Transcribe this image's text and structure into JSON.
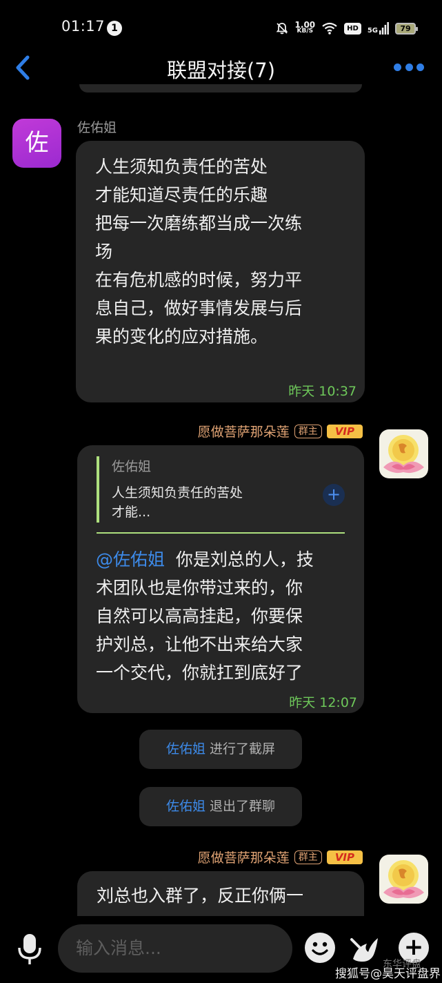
{
  "status_bar": {
    "time": "01:17",
    "notification_count": "1",
    "net_speed_value": "1.00",
    "net_speed_unit": "KB/S",
    "hd": "HD",
    "network": "5G",
    "battery": "79"
  },
  "header": {
    "title": "联盟对接(7)"
  },
  "messages": [
    {
      "sender": "佐佑姐",
      "avatar_char": "佐",
      "text": "人生须知负责任的苦处\n才能知道尽责任的乐趣\n把每一次磨练都当成一次练\n场\n在有危机感的时候，努力平\n息自己，做好事情发展与后\n果的变化的应对措施。",
      "time": "昨天 10:37"
    },
    {
      "sender": "愿做菩萨那朵莲",
      "role_tag": "群主",
      "vip_tag": "VIP",
      "quote_name": "佐佑姐",
      "quote_text": "人生须知负责任的苦处\n才能...",
      "mention": "@佐佑姐",
      "text": "  你是刘总的人，技\n术团队也是你带过来的，你\n自然可以高高挂起，你要保\n护刘总，让他不出来给大家\n一个交代，你就扛到底好了",
      "time": "昨天 12:07"
    },
    {
      "sender": "愿做菩萨那朵莲",
      "role_tag": "群主",
      "vip_tag": "VIP",
      "text": "刘总也入群了，反正你俩一"
    }
  ],
  "system_notices": [
    {
      "who": "佐佑姐",
      "action": " 进行了截屏"
    },
    {
      "who": "佐佑姐",
      "action": " 退出了群聊"
    }
  ],
  "input": {
    "placeholder": "输入消息..."
  },
  "watermark": {
    "top_text": "东华评盘",
    "text": "搜狐号@昊天评盘界"
  },
  "colors": {
    "accent_blue": "#2f7ee6",
    "time_green": "#6ec85a",
    "owner_orange": "#e0a374",
    "quote_bar": "#aee07e",
    "vip_bg": "#f5c045",
    "bubble_bg": "#262626"
  }
}
